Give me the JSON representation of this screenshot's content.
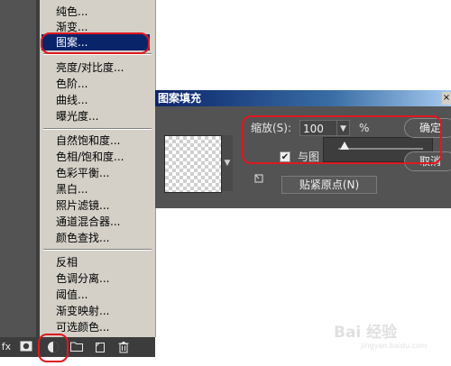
{
  "adjustment_menu": {
    "groups": [
      {
        "items": [
          {
            "label": "纯色..."
          },
          {
            "label": "渐变..."
          },
          {
            "label": "图案...",
            "selected": true
          }
        ]
      },
      {
        "items": [
          {
            "label": "亮度/对比度..."
          },
          {
            "label": "色阶..."
          },
          {
            "label": "曲线..."
          },
          {
            "label": "曝光度..."
          }
        ]
      },
      {
        "items": [
          {
            "label": "自然饱和度..."
          },
          {
            "label": "色相/饱和度..."
          },
          {
            "label": "色彩平衡..."
          },
          {
            "label": "黑白..."
          },
          {
            "label": "照片滤镜..."
          },
          {
            "label": "通道混合器..."
          },
          {
            "label": "颜色查找..."
          }
        ]
      },
      {
        "items": [
          {
            "label": "反相"
          },
          {
            "label": "色调分离..."
          },
          {
            "label": "阈值..."
          },
          {
            "label": "渐变映射..."
          },
          {
            "label": "可选颜色..."
          }
        ]
      }
    ]
  },
  "layers_toolbar": {
    "fx_label": "fx",
    "icons": [
      "mask-icon",
      "adjustment-layer-icon",
      "folder-icon",
      "new-layer-icon",
      "trash-icon"
    ]
  },
  "dialog": {
    "title": "图案填充",
    "close_glyph": "×",
    "scale_label": "缩放(S):",
    "scale_value": "100",
    "percent": "%",
    "ok_label": "确定",
    "cancel_label": "取消",
    "link_label": "与图",
    "snap_origin_label": "贴紧原点(N)",
    "link_checked": true,
    "slider_value_percent": 100
  },
  "colors": {
    "highlight": "#0a246a",
    "annotation": "#e0181e",
    "panel": "#535353",
    "menu_bg": "#d4d0c8"
  },
  "watermark": {
    "text": "Bai 经验",
    "sub": "jingyan.baidu.com"
  }
}
